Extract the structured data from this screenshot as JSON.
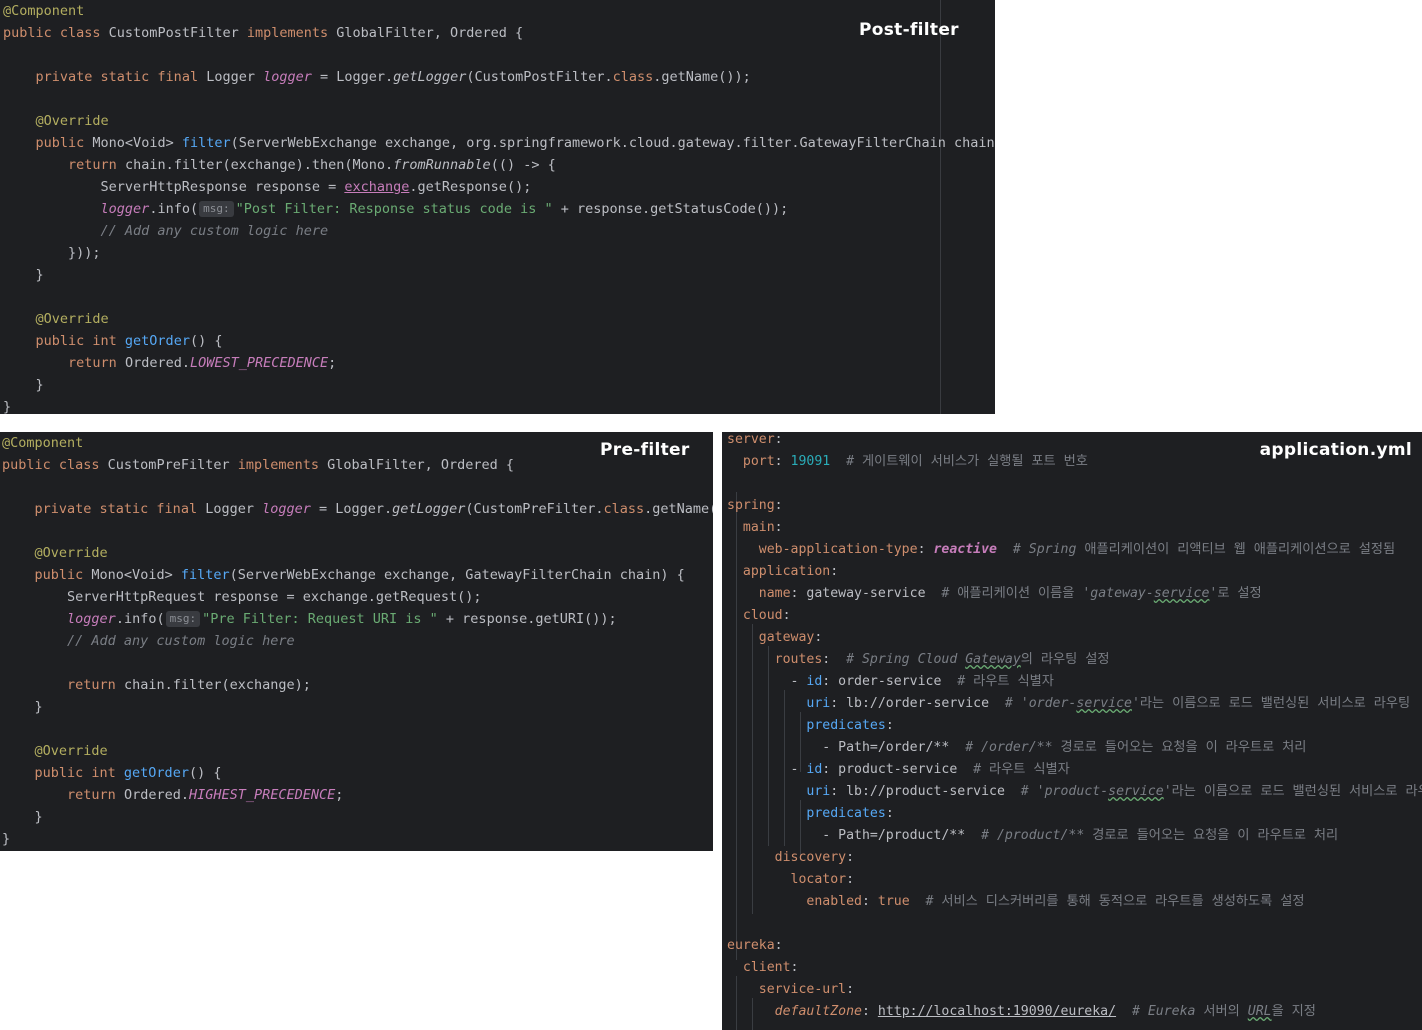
{
  "post_filter": {
    "title": "Post-filter",
    "lines": [
      "@Component",
      "public class CustomPostFilter implements GlobalFilter, Ordered {",
      "",
      "    private static final Logger logger = Logger.getLogger(CustomPostFilter.class.getName());",
      "",
      "    @Override",
      "    public Mono<Void> filter(ServerWebExchange exchange, org.springframework.cloud.gateway.filter.GatewayFilterChain chain) {",
      "        return chain.filter(exchange).then(Mono.fromRunnable(() -> {",
      "            ServerHttpResponse response = exchange.getResponse();",
      "            logger.info( msg: \"Post Filter: Response status code is \" + response.getStatusCode());",
      "            // Add any custom logic here",
      "        }));",
      "    }",
      "",
      "    @Override",
      "    public int getOrder() {",
      "        return Ordered.LOWEST_PRECEDENCE;",
      "    }",
      "}"
    ]
  },
  "pre_filter": {
    "title": "Pre-filter",
    "lines": [
      "@Component",
      "public class CustomPreFilter implements GlobalFilter, Ordered {",
      "",
      "    private static final Logger logger = Logger.getLogger(CustomPreFilter.class.getName());",
      "",
      "    @Override",
      "    public Mono<Void> filter(ServerWebExchange exchange, GatewayFilterChain chain) {",
      "        ServerHttpRequest response = exchange.getRequest();",
      "        logger.info( msg: \"Pre Filter: Request URI is \" + response.getURI());",
      "        // Add any custom logic here",
      "",
      "        return chain.filter(exchange);",
      "    }",
      "",
      "    @Override",
      "    public int getOrder() {",
      "        return Ordered.HIGHEST_PRECEDENCE;",
      "    }",
      "}"
    ]
  },
  "application_yml": {
    "title": "application.yml",
    "lines": [
      "server:",
      "  port: 19091  # 게이트웨이 서비스가 실행될 포트 번호",
      "",
      "spring:",
      "  main:",
      "    web-application-type: reactive  # Spring 애플리케이션이 리액티브 웹 애플리케이션으로 설정됨",
      "  application:",
      "    name: gateway-service  # 애플리케이션 이름을 'gateway-service'로 설정",
      "  cloud:",
      "    gateway:",
      "      routes:  # Spring Cloud Gateway의 라우팅 설정",
      "        - id: order-service  # 라우트 식별자",
      "          uri: lb://order-service  # 'order-service'라는 이름으로 로드 밸런싱된 서비스로 라우팅",
      "          predicates:",
      "            - Path=/order/**  # /order/** 경로로 들어오는 요청을 이 라우트로 처리",
      "        - id: product-service  # 라우트 식별자",
      "          uri: lb://product-service  # 'product-service'라는 이름으로 로드 밸런싱된 서비스로 라우팅",
      "          predicates:",
      "            - Path=/product/**  # /product/** 경로로 들어오는 요청을 이 라우트로 처리",
      "      discovery:",
      "        locator:",
      "          enabled: true  # 서비스 디스커버리를 통해 동적으로 라우트를 생성하도록 설정",
      "",
      "eureka:",
      "  client:",
      "    service-url:",
      "      defaultZone: http://localhost:19090/eureka/  # Eureka 서버의 URL을 지정"
    ]
  },
  "colors": {
    "editor_bg": "#1e1f22",
    "keyword": "#cf8e6d",
    "annotation": "#b3ae60",
    "field": "#c77dbb",
    "method": "#56a8f5",
    "string": "#6aab73",
    "comment": "#7a7e85",
    "number": "#2aacb8"
  }
}
